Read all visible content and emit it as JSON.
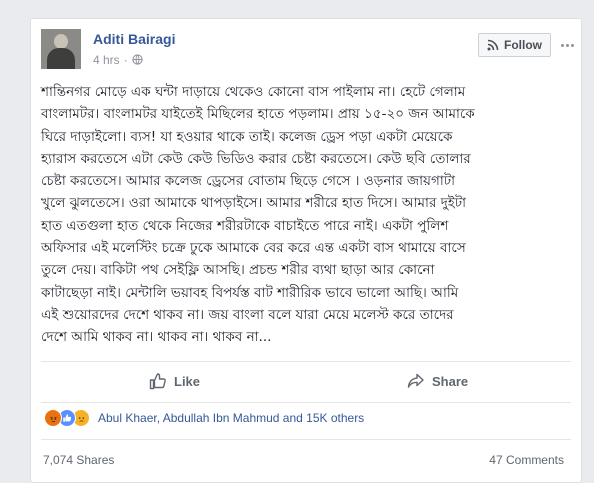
{
  "post": {
    "author": "Aditi Bairagi",
    "time": "4 hrs",
    "follow_label": "Follow",
    "lines": [
      "শান্তিনগর মোড়ে এক ঘন্টা দাড়ায়ে থেকেও কোনো বাস পাইলাম না। হেটে গেলাম",
      "বাংলামটর। বাংলামটর যাইতেই মিছিলের হাতে পড়লাম। প্রায় ১৫-২০ জন আমাকে",
      "ঘিরে দাড়াইলো। ব্যস! যা হওয়ার থাকে তাই। কলেজ ড্রেস পড়া একটা মেয়েকে",
      "হ্যারাস করতেসে এটা কেউ কেউ ভিডিও করার চেষ্টা করতেসে। কেউ ছবি তোলার",
      "চেষ্টা করতেসে। আমার কলেজ ড্রেসের বোতাম ছিড়ে গেসে । ওড়নার জায়গাটা",
      "খুলে ঝুলতেসে। ওরা আমাকে থাপড়াইসে। আমার শরীরে হাত দিসে। আমার দুইটা",
      "হাত এতগুলা হাত থেকে নিজের শরীরটাকে বাচাইতে পারে নাই। একটা পুলিশ",
      "অফিসার এই মলেস্টিং চক্রে ঢুকে আমাকে বের করে এন্ত একটা বাস থামায়ে বাসে",
      "তুলে দেয়। বাকিটা পথ সেইফ্লি আসছি। প্রচন্ড শরীর ব্যথা ছাড়া আর কোনো",
      "কাটাছেড়া নাই। মেন্টালি ভয়াবহ বিপর্যস্ত বাট শারীরিক ভাবে ভালো আছি। আমি",
      "এই শুয়োরদের দেশে থাকব না। জয় বাংলা বলে যারা মেয়ে মলেস্ট করে তাদের",
      "দেশে আমি থাকব না। থাকব না। থাকব না..."
    ]
  },
  "actions": {
    "like_label": "Like",
    "share_label": "Share"
  },
  "engagement": {
    "reactors": "Abul Khaer, Abdullah Ibn Mahmud and 15K others",
    "shares": "7,074 Shares",
    "comments": "47 Comments"
  },
  "colors": {
    "link": "#365899",
    "muted": "#90949c",
    "angry": "#e9710f",
    "like": "#5890ff",
    "sad": "#f7b125"
  },
  "icons": {
    "privacy": "globe-icon",
    "follow": "rss-icon",
    "like": "thumbs-up-icon",
    "share": "share-arrow-icon"
  }
}
